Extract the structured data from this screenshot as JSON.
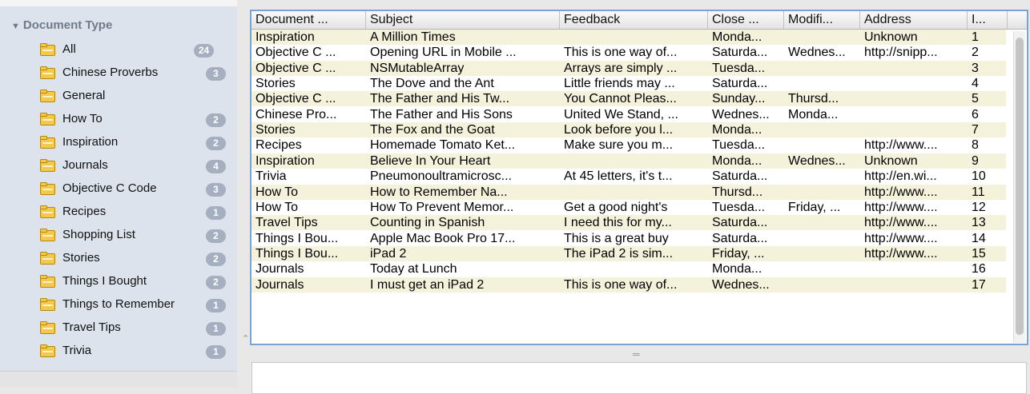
{
  "sidebar": {
    "section_title": "Document Type",
    "items": [
      {
        "label": "All",
        "count": "24"
      },
      {
        "label": "Chinese Proverbs",
        "count": "3"
      },
      {
        "label": "General",
        "count": ""
      },
      {
        "label": "How To",
        "count": "2"
      },
      {
        "label": "Inspiration",
        "count": "2"
      },
      {
        "label": "Journals",
        "count": "4"
      },
      {
        "label": "Objective C Code",
        "count": "3"
      },
      {
        "label": "Recipes",
        "count": "1"
      },
      {
        "label": "Shopping List",
        "count": "2"
      },
      {
        "label": "Stories",
        "count": "2"
      },
      {
        "label": "Things I Bought",
        "count": "2"
      },
      {
        "label": "Things to Remember",
        "count": "1"
      },
      {
        "label": "Travel Tips",
        "count": "1"
      },
      {
        "label": "Trivia",
        "count": "1"
      }
    ]
  },
  "table": {
    "columns": [
      "Document ...",
      "Subject",
      "Feedback",
      "Close ...",
      "Modifi...",
      "Address",
      "I..."
    ],
    "rows": [
      [
        "Inspiration",
        "A Million Times",
        "",
        "Monda...",
        "",
        "Unknown",
        "1"
      ],
      [
        "Objective C ...",
        "Opening URL in Mobile ...",
        "This is one way of...",
        "Saturda...",
        "Wednes...",
        "http://snipp...",
        "2"
      ],
      [
        "Objective C ...",
        "NSMutableArray",
        "Arrays are simply ...",
        "Tuesda...",
        "",
        "",
        "3"
      ],
      [
        "Stories",
        "The Dove and the Ant",
        "Little friends may ...",
        "Saturda...",
        "",
        "",
        "4"
      ],
      [
        "Objective C ...",
        "The Father and His Tw...",
        "You Cannot Pleas...",
        "Sunday...",
        "Thursd...",
        "",
        "5"
      ],
      [
        "Chinese Pro...",
        "The Father and His Sons",
        "United We Stand, ...",
        "Wednes...",
        "Monda...",
        "",
        "6"
      ],
      [
        "Stories",
        "The Fox and the Goat",
        "Look before you l...",
        "Monda...",
        "",
        "",
        "7"
      ],
      [
        "Recipes",
        "Homemade Tomato Ket...",
        "Make sure you m...",
        "Tuesda...",
        "",
        "http://www....",
        "8"
      ],
      [
        "Inspiration",
        "Believe In Your Heart",
        "",
        "Monda...",
        "Wednes...",
        "Unknown",
        "9"
      ],
      [
        "Trivia",
        "Pneumonoultramicrosc...",
        "At 45 letters, it's t...",
        "Saturda...",
        "",
        "http://en.wi...",
        "10"
      ],
      [
        "How To",
        "How to Remember Na...",
        "",
        "Thursd...",
        "",
        "http://www....",
        "11"
      ],
      [
        "How To",
        "How To Prevent Memor...",
        "Get a good night's",
        "Tuesda...",
        "Friday, ...",
        "http://www....",
        "12"
      ],
      [
        "Travel Tips",
        "Counting in Spanish",
        "I need this for my...",
        "Saturda...",
        "",
        "http://www....",
        "13"
      ],
      [
        "Things I Bou...",
        "Apple Mac Book Pro 17...",
        "This is a great buy",
        "Saturda...",
        "",
        "http://www....",
        "14"
      ],
      [
        "Things I Bou...",
        "iPad 2",
        "The iPad 2 is sim...",
        "Friday, ...",
        "",
        "http://www....",
        "15"
      ],
      [
        "Journals",
        "Today at Lunch",
        "",
        "Monda...",
        "",
        "",
        "16"
      ],
      [
        "Journals",
        "I must get an iPad 2",
        "This is one way of...",
        "Wednes...",
        "",
        "",
        "17"
      ]
    ]
  },
  "colors": {
    "sidebar_bg": "#dce3ec",
    "badge_bg": "#a5afbf",
    "row_alt": "#f5f2dc",
    "focus_border": "#7ba4d6",
    "folder_icon": "#f2c94c"
  }
}
